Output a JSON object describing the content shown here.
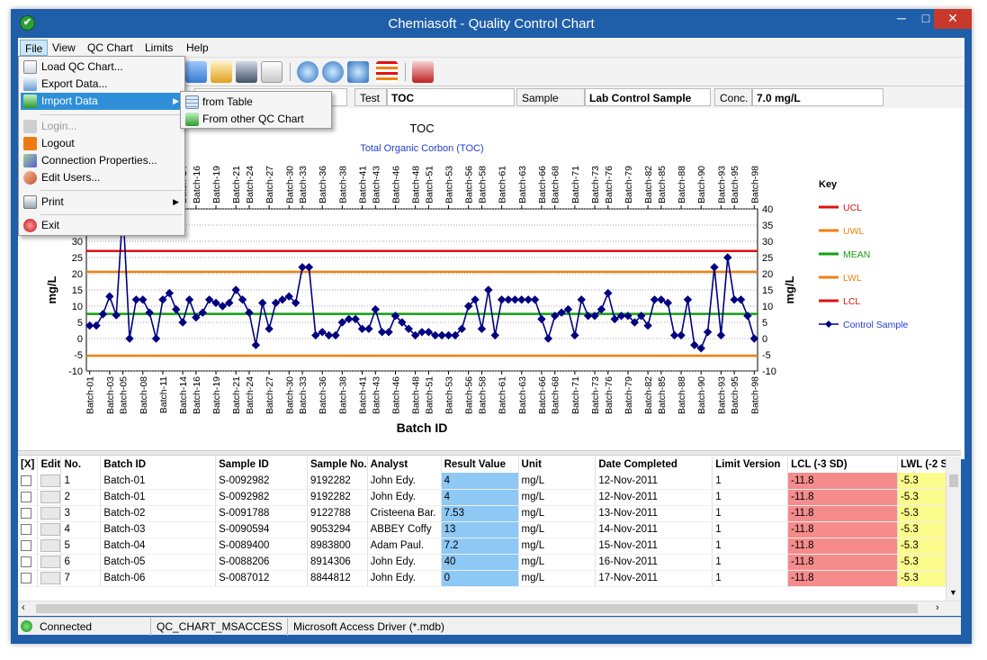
{
  "window": {
    "title": "Chemiasoft - Quality Control Chart",
    "minimize": "─",
    "maximize": "□",
    "close": "✕"
  },
  "menu": {
    "items": [
      "File",
      "View",
      "QC Chart",
      "Limits",
      "Help"
    ]
  },
  "file_menu": {
    "items": [
      {
        "label": "Load QC Chart...",
        "icon": "load-chart-icon"
      },
      {
        "label": "Export Data...",
        "icon": "export-icon"
      },
      {
        "label": "Import Data",
        "icon": "import-icon",
        "highlighted": true,
        "submenu": true
      },
      {
        "label": "Login...",
        "icon": "login-icon",
        "disabled": true
      },
      {
        "label": "Logout",
        "icon": "logout-icon"
      },
      {
        "label": "Connection Properties...",
        "icon": "connection-icon"
      },
      {
        "label": "Edit Users...",
        "icon": "users-icon"
      },
      {
        "label": "Print",
        "icon": "print-icon",
        "submenu": true
      },
      {
        "label": "Exit",
        "icon": "exit-icon"
      }
    ]
  },
  "import_submenu": {
    "items": [
      "from Table",
      "From other QC Chart"
    ]
  },
  "infobar": {
    "test_label": "Test",
    "test_value": "TOC",
    "sample_type_label": "Sample Type",
    "sample_type_value": "Lab Control Sample",
    "conc_label": "Conc.",
    "conc_value": "7.0 mg/L"
  },
  "chart_data": {
    "type": "line",
    "title": "TOC",
    "subtitle": "Total Organic Corbon (TOC)",
    "xlabel": "Batch ID",
    "ylabel": "mg/L",
    "ylim": [
      -10,
      40
    ],
    "yticks": [
      -10,
      -5,
      0,
      5,
      10,
      15,
      20,
      25,
      30,
      35,
      40
    ],
    "x_tick_labels": [
      "Batch-01",
      "Batch-03",
      "Batch-05",
      "Batch-08",
      "Batch-11",
      "Batch-14",
      "Batch-16",
      "Batch-19",
      "Batch-21",
      "Batch-24",
      "Batch-27",
      "Batch-30",
      "Batch-33",
      "Batch-36",
      "Batch-38",
      "Batch-41",
      "Batch-43",
      "Batch-46",
      "Batch-48",
      "Batch-51",
      "Batch-53",
      "Batch-56",
      "Batch-58",
      "Batch-61",
      "Batch-63",
      "Batch-66",
      "Batch-68",
      "Batch-71",
      "Batch-73",
      "Batch-76",
      "Batch-79",
      "Batch-82",
      "Batch-85",
      "Batch-88",
      "Batch-90",
      "Batch-93",
      "Batch-95",
      "Batch-98"
    ],
    "limits": [
      {
        "name": "UCL",
        "value": 27,
        "color": "#e01010"
      },
      {
        "name": "UWL",
        "value": 20.6,
        "color": "#f08010"
      },
      {
        "name": "MEAN",
        "value": 7.6,
        "color": "#10a010"
      },
      {
        "name": "LWL",
        "value": -5.3,
        "color": "#f08010"
      },
      {
        "name": "LCL",
        "value": -11.8,
        "color": "#e01010"
      }
    ],
    "series": [
      {
        "name": "Control Sample",
        "color": "#000080",
        "values": [
          4,
          4,
          7.53,
          13,
          7.2,
          40,
          0,
          12,
          12,
          8,
          0,
          12,
          14,
          9,
          5,
          12,
          6.5,
          8,
          12,
          11,
          10,
          11,
          15,
          12,
          8,
          -2,
          11,
          3,
          11,
          12,
          13,
          11,
          22,
          22,
          1,
          2,
          1,
          1,
          5,
          6,
          6,
          3,
          3,
          9,
          2,
          2,
          7,
          5,
          3,
          1,
          2,
          2,
          1,
          1,
          1,
          1,
          3,
          10,
          12,
          3,
          15,
          1,
          12,
          12,
          12,
          12,
          12,
          12,
          6,
          0,
          7,
          8,
          9,
          1,
          12,
          7,
          7,
          9,
          14,
          6,
          7,
          7,
          5,
          7,
          4,
          12,
          12,
          11,
          1,
          1,
          12,
          -2,
          -3,
          2,
          22,
          1,
          25,
          12,
          12,
          7,
          0
        ]
      }
    ],
    "legend_title": "Key",
    "legend_placement": "right"
  },
  "table": {
    "columns": [
      "[X]",
      "Edit",
      "No.",
      "Batch ID",
      "Sample ID",
      "Sample No.",
      "Analyst",
      "Result Value",
      "Unit",
      "Date Completed",
      "Limit Version",
      "LCL (-3 SD)",
      "LWL (-2 S"
    ],
    "rows": [
      [
        "1",
        "Batch-01",
        "S-0092982",
        "9192282",
        "John Edy.",
        "4",
        "mg/L",
        "12-Nov-2011",
        "1",
        "-11.8",
        "-5.3"
      ],
      [
        "2",
        "Batch-01",
        "S-0092982",
        "9192282",
        "John Edy.",
        "4",
        "mg/L",
        "12-Nov-2011",
        "1",
        "-11.8",
        "-5.3"
      ],
      [
        "3",
        "Batch-02",
        "S-0091788",
        "9122788",
        "Cristeena Bar.",
        "7.53",
        "mg/L",
        "13-Nov-2011",
        "1",
        "-11.8",
        "-5.3"
      ],
      [
        "4",
        "Batch-03",
        "S-0090594",
        "9053294",
        "ABBEY Coffy",
        "13",
        "mg/L",
        "14-Nov-2011",
        "1",
        "-11.8",
        "-5.3"
      ],
      [
        "5",
        "Batch-04",
        "S-0089400",
        "8983800",
        "Adam Paul.",
        "7.2",
        "mg/L",
        "15-Nov-2011",
        "1",
        "-11.8",
        "-5.3"
      ],
      [
        "6",
        "Batch-05",
        "S-0088206",
        "8914306",
        "John Edy.",
        "40",
        "mg/L",
        "16-Nov-2011",
        "1",
        "-11.8",
        "-5.3"
      ],
      [
        "7",
        "Batch-06",
        "S-0087012",
        "8844812",
        "John Edy.",
        "0",
        "mg/L",
        "17-Nov-2011",
        "1",
        "-11.8",
        "-5.3"
      ]
    ]
  },
  "status": {
    "connection": "Connected",
    "database": "QC_CHART_MSACCESS",
    "driver": "Microsoft Access Driver (*.mdb)"
  },
  "colors": {
    "title_bar": "#1f5fa9",
    "menu_highlight": "#2e8fd8",
    "result_cell": "#8ec8f5",
    "lcl_cell": "#f58b8b",
    "lwl_cell": "#fbfb8c"
  }
}
